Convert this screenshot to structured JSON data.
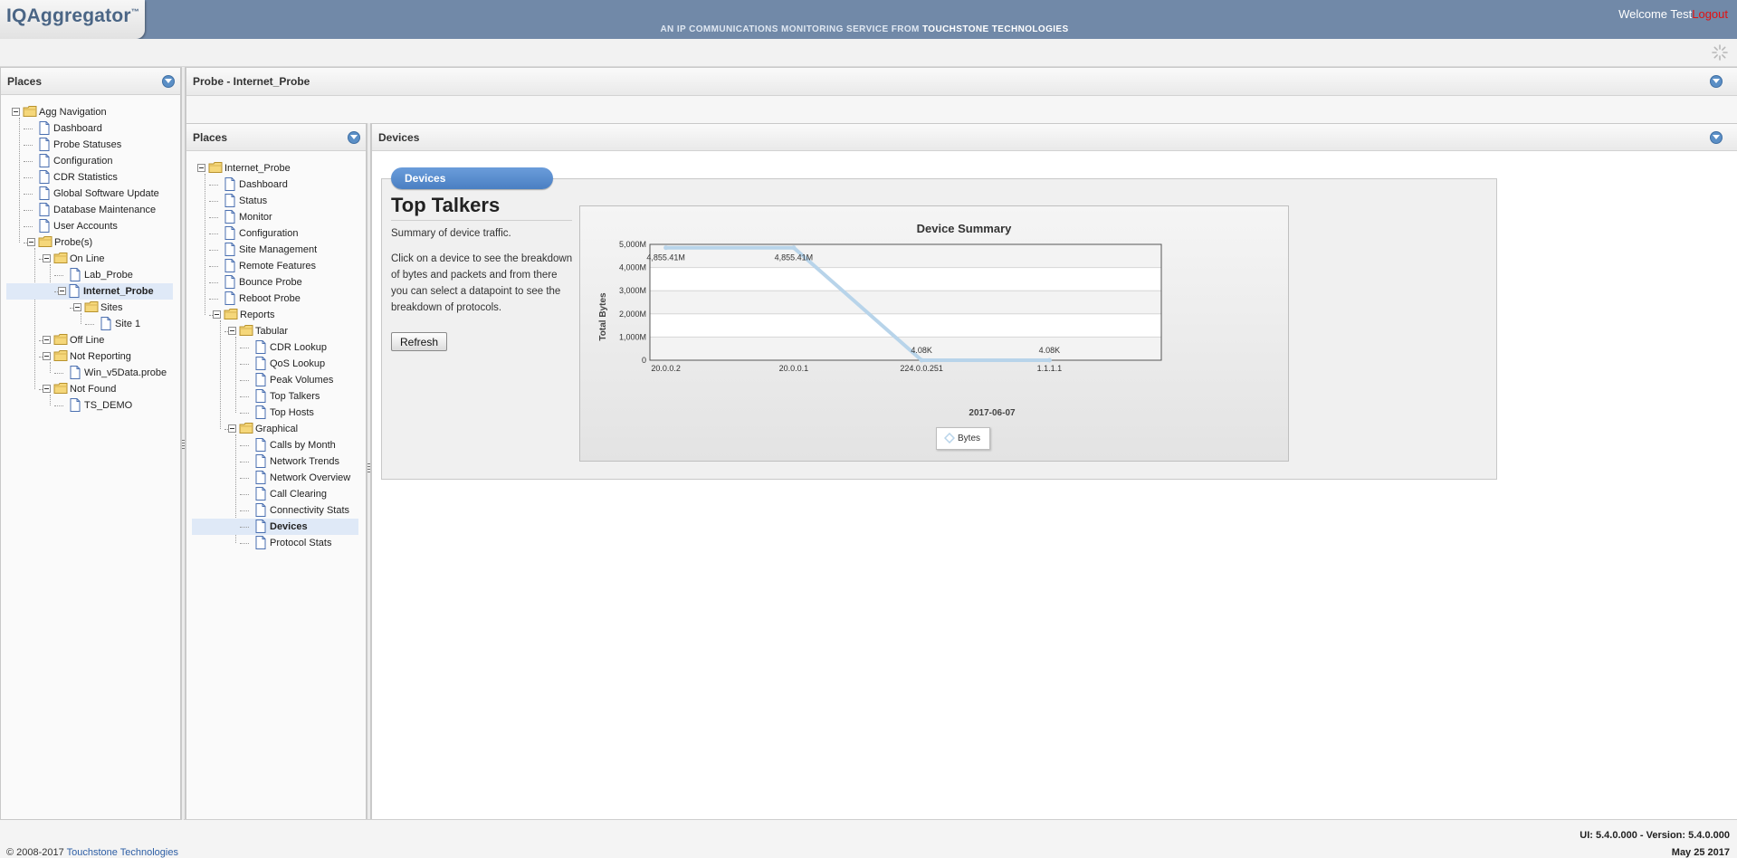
{
  "header": {
    "logo": "IQAggregator",
    "logo_tm": "™",
    "tagline_prefix": "AN IP COMMUNICATIONS MONITORING SERVICE FROM ",
    "tagline_brand": "TOUCHSTONE TECHNOLOGIES",
    "welcome": "Welcome Test",
    "logout": "Logout"
  },
  "left_panel": {
    "title": "Places",
    "tree": [
      "Agg Navigation",
      "Dashboard",
      "Probe Statuses",
      "Configuration",
      "CDR Statistics",
      "Global Software Update",
      "Database Maintenance",
      "User Accounts",
      "Probe(s)",
      "On Line",
      "Lab_Probe",
      "Internet_Probe",
      "Sites",
      "Site 1",
      "Off Line",
      "Not Reporting",
      "Win_v5Data.probe",
      "Not Found",
      "TS_DEMO"
    ]
  },
  "probe_panel": {
    "title": "Probe - Internet_Probe"
  },
  "middle_panel": {
    "title": "Places",
    "tree": [
      "Internet_Probe",
      "Dashboard",
      "Status",
      "Monitor",
      "Configuration",
      "Site Management",
      "Remote Features",
      "Bounce Probe",
      "Reboot Probe",
      "Reports",
      "Tabular",
      "CDR Lookup",
      "QoS Lookup",
      "Peak Volumes",
      "Top Talkers",
      "Top Hosts",
      "Graphical",
      "Calls by Month",
      "Network Trends",
      "Network Overview",
      "Call Clearing",
      "Connectivity Stats",
      "Devices",
      "Protocol Stats"
    ]
  },
  "devices_panel": {
    "title": "Devices",
    "legend": "Devices",
    "heading": "Top Talkers",
    "summary": "Summary of device traffic.",
    "description": "Click on a device to see the breakdown of bytes and packets and from there you can select a datapoint to see the breakdown of protocols.",
    "refresh": "Refresh"
  },
  "chart_data": {
    "type": "line",
    "title": "Device Summary",
    "xlabel": "2017-06-07",
    "ylabel": "Total Bytes",
    "categories": [
      "20.0.0.2",
      "20.0.0.1",
      "224.0.0.251",
      "1.1.1.1"
    ],
    "series": [
      {
        "name": "Bytes",
        "values": [
          4855.41,
          4855.41,
          0.00408,
          0.00408
        ],
        "labels": [
          "4,855.41M",
          "4,855.41M",
          "4.08K",
          "4.08K"
        ],
        "color": "#b8d4ea"
      }
    ],
    "yticks": [
      "0",
      "1,000M",
      "2,000M",
      "3,000M",
      "4,000M",
      "5,000M"
    ],
    "ylim": [
      0,
      5000
    ],
    "grid": true,
    "legend_placement": "bottom-center"
  },
  "footer": {
    "copyright_prefix": "© 2008-2017 ",
    "copyright_link": "Touchstone Technologies",
    "version": "UI: 5.4.0.000 - Version: 5.4.0.000",
    "date": "May 25 2017"
  },
  "colors": {
    "header": "#7189a8",
    "accent": "#5b8fc6",
    "selected": "#dfe9f7",
    "logout": "#e41010"
  }
}
